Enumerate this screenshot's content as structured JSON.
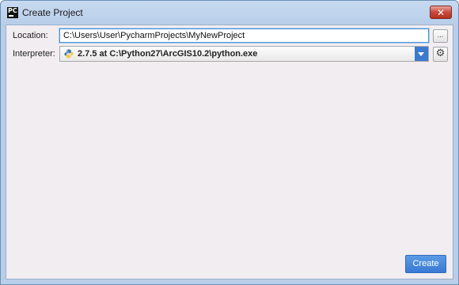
{
  "window": {
    "title": "Create Project",
    "app_icon_text": "PC",
    "close_glyph": "✕"
  },
  "form": {
    "location_label": "Location:",
    "location_value": "C:\\Users\\User\\PycharmProjects\\MyNewProject",
    "browse_label": "...",
    "interpreter_label": "Interpreter:",
    "interpreter_value": "2.7.5 at C:\\Python27\\ArcGIS10.2\\python.exe",
    "interpreter_icon": "python-icon",
    "settings_icon": "gear-icon"
  },
  "footer": {
    "create_label": "Create"
  },
  "colors": {
    "accent": "#3a7ad4",
    "client_bg": "#f1edf1",
    "close": "#c9493a"
  }
}
